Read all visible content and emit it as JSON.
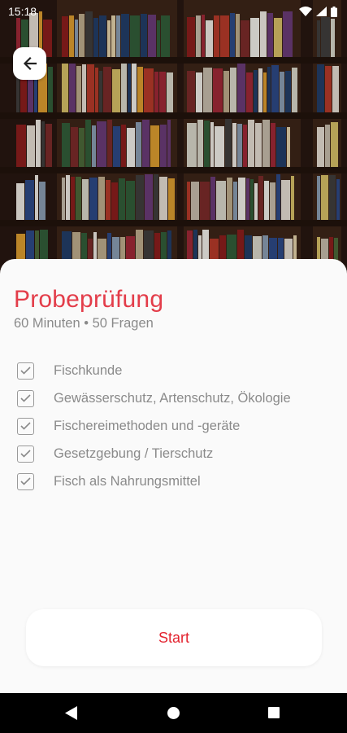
{
  "status_bar": {
    "time": "15:18"
  },
  "header": {
    "back_icon": "arrow-left-icon"
  },
  "exam": {
    "title": "Probeprüfung",
    "subtitle": "60 Minuten • 50 Fragen",
    "topics": [
      {
        "label": "Fischkunde",
        "checked": true
      },
      {
        "label": "Gewässerschutz, Artenschutz, Ökologie",
        "checked": true
      },
      {
        "label": "Fischereimethoden und -geräte",
        "checked": true
      },
      {
        "label": "Gesetzgebung / Tierschutz",
        "checked": true
      },
      {
        "label": "Fisch als Nahrungsmittel",
        "checked": true
      }
    ],
    "start_label": "Start",
    "accent_color": "#e3232f"
  },
  "nav_bar": {
    "icons": [
      "back-triangle-icon",
      "home-circle-icon",
      "recents-square-icon"
    ]
  }
}
